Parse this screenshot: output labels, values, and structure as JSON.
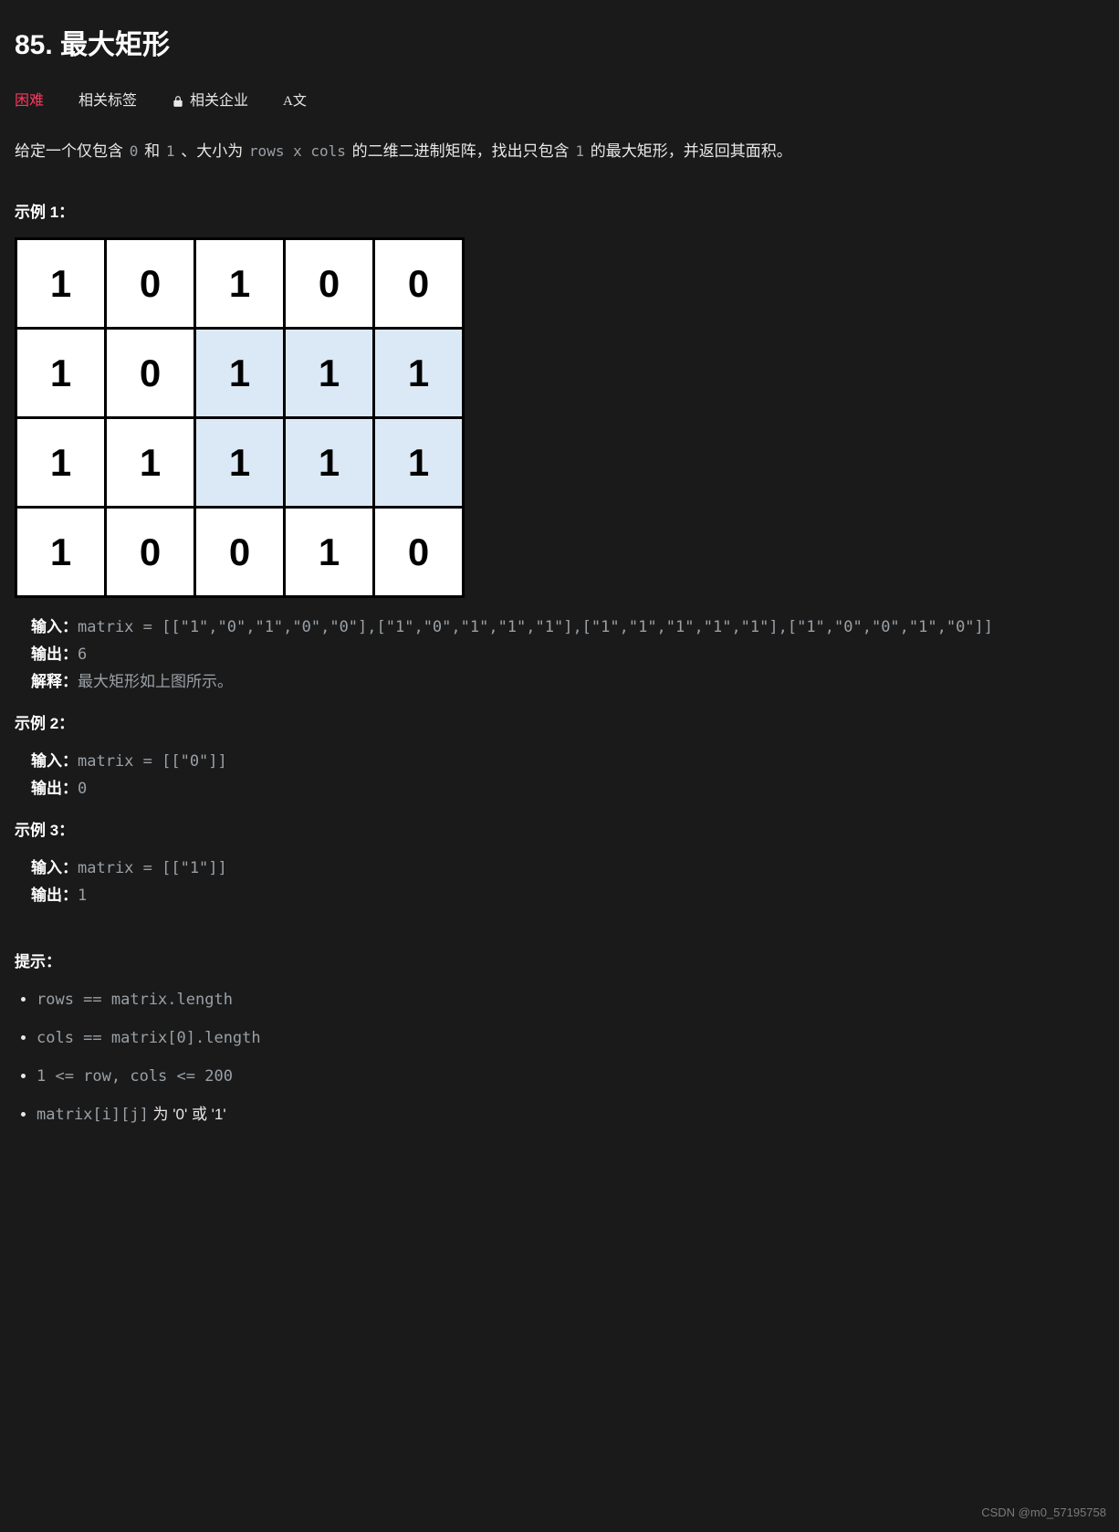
{
  "title": "85. 最大矩形",
  "meta": {
    "difficulty": "困难",
    "tags_label": "相关标签",
    "companies_label": "相关企业",
    "font_switch": "A文"
  },
  "description": {
    "p1": "给定一个仅包含 ",
    "c1": "0",
    "p2": " 和 ",
    "c2": "1",
    "p3": " 、大小为 ",
    "c3": "rows x cols",
    "p4": " 的二维二进制矩阵，找出只包含 ",
    "c4": "1",
    "p5": " 的最大矩形，并返回其面积。"
  },
  "example1_heading": "示例 1：",
  "matrix": {
    "rows": [
      [
        "1",
        "0",
        "1",
        "0",
        "0"
      ],
      [
        "1",
        "0",
        "1",
        "1",
        "1"
      ],
      [
        "1",
        "1",
        "1",
        "1",
        "1"
      ],
      [
        "1",
        "0",
        "0",
        "1",
        "0"
      ]
    ],
    "highlight": [
      [
        false,
        false,
        false,
        false,
        false
      ],
      [
        false,
        false,
        true,
        true,
        true
      ],
      [
        false,
        false,
        true,
        true,
        true
      ],
      [
        false,
        false,
        false,
        false,
        false
      ]
    ]
  },
  "example1": {
    "input_label": "输入：",
    "input_value": "matrix = [[\"1\",\"0\",\"1\",\"0\",\"0\"],[\"1\",\"0\",\"1\",\"1\",\"1\"],[\"1\",\"1\",\"1\",\"1\",\"1\"],[\"1\",\"0\",\"0\",\"1\",\"0\"]]",
    "output_label": "输出：",
    "output_value": "6",
    "explain_label": "解释：",
    "explain_value": "最大矩形如上图所示。"
  },
  "example2_heading": "示例 2：",
  "example2": {
    "input_label": "输入：",
    "input_value": "matrix = [[\"0\"]]",
    "output_label": "输出：",
    "output_value": "0"
  },
  "example3_heading": "示例 3：",
  "example3": {
    "input_label": "输入：",
    "input_value": "matrix = [[\"1\"]]",
    "output_label": "输出：",
    "output_value": "1"
  },
  "constraints_heading": "提示：",
  "constraints": [
    {
      "code": "rows == matrix.length",
      "tail": ""
    },
    {
      "code": "cols == matrix[0].length",
      "tail": ""
    },
    {
      "code": "1 <= row, cols <= 200",
      "tail": ""
    },
    {
      "code": "matrix[i][j]",
      "tail": " 为 '0' 或 '1'"
    }
  ],
  "watermark": "CSDN @m0_57195758"
}
